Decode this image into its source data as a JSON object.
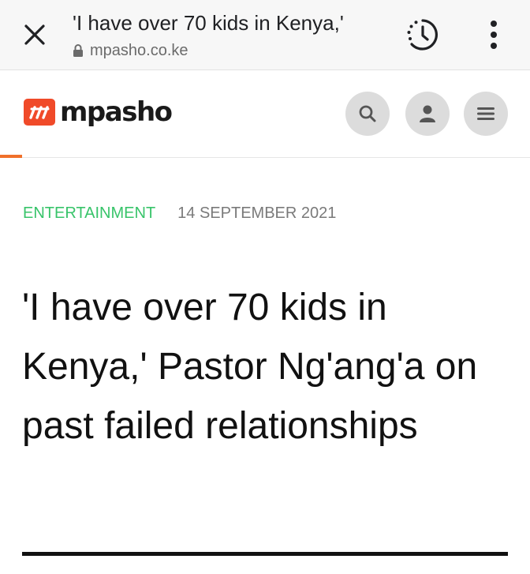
{
  "browser": {
    "tab_title": "'I have over 70 kids in Kenya,'",
    "url": "mpasho.co.ke"
  },
  "site": {
    "logo_text": "mpasho",
    "logo_mark": "m",
    "brand_color": "#f04a29",
    "header_icons": [
      "search-icon",
      "user-icon",
      "hamburger-menu-icon"
    ]
  },
  "article": {
    "category": "ENTERTAINMENT",
    "category_color": "#38c46a",
    "date": "14 SEPTEMBER 2021",
    "headline": "'I have over 70 kids in Kenya,' Pastor Ng'ang'a on past failed relationships"
  }
}
